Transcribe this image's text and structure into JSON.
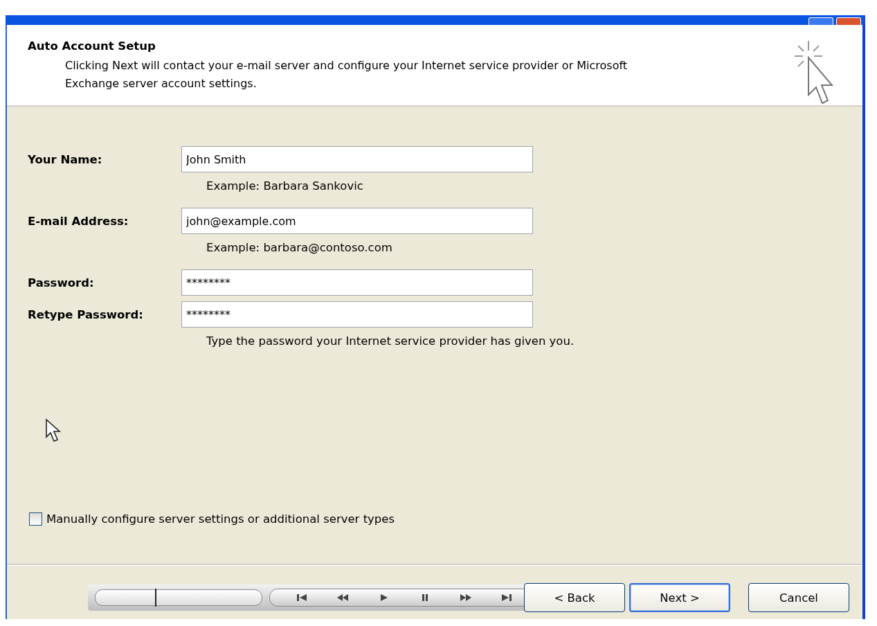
{
  "header": {
    "title": "Auto Account Setup",
    "description_lines": [
      "Clicking Next will contact your e-mail server and configure your Internet service provider or Microsoft",
      "Exchange server account settings."
    ]
  },
  "fields": [
    {
      "label": "Your Name:",
      "value": "John Smith",
      "hint": "Example: Barbara Sankovic"
    },
    {
      "label": "E-mail Address:",
      "value": "john@example.com",
      "hint": "Example: barbara@contoso.com"
    },
    {
      "label": "Password:",
      "value": "********"
    },
    {
      "label": "Retype Password:",
      "value": "********",
      "hint": "Type the password your Internet service provider has given you."
    }
  ],
  "manual_config": {
    "label": "Manually configure server settings or additional server types",
    "checked": false
  },
  "media_player": {
    "level": 0.36
  },
  "buttons": [
    {
      "label": "< Back",
      "focused": false
    },
    {
      "label": "Next >",
      "focused": true
    },
    {
      "label": "Cancel",
      "focused": false
    }
  ]
}
